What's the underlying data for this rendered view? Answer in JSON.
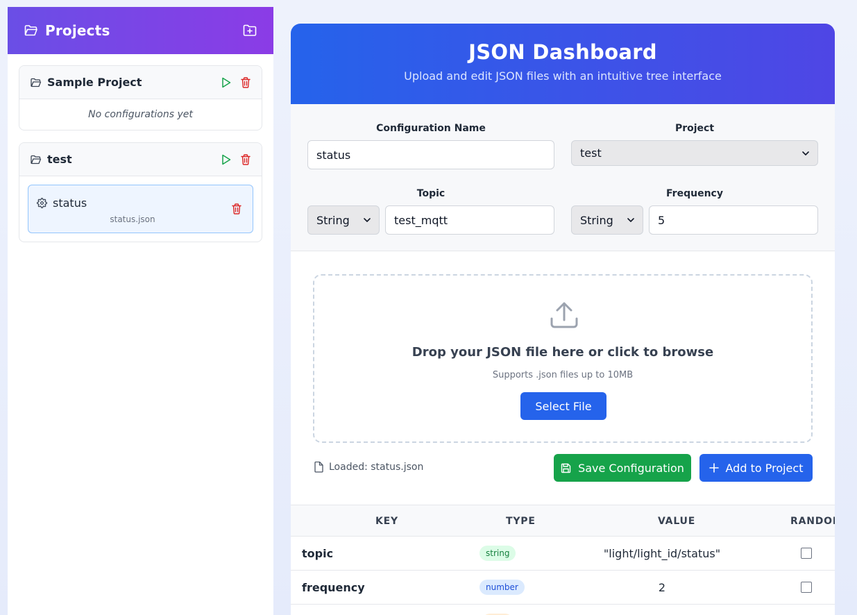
{
  "sidebar": {
    "title": "Projects",
    "projects": [
      {
        "name": "Sample Project",
        "empty_text": "No configurations yet"
      },
      {
        "name": "test",
        "configs": [
          {
            "name": "status",
            "file": "status.json"
          }
        ]
      }
    ]
  },
  "main": {
    "title": "JSON Dashboard",
    "subtitle": "Upload and edit JSON files with an intuitive tree interface",
    "form": {
      "config_name_label": "Configuration Name",
      "config_name_value": "status",
      "project_label": "Project",
      "project_value": "test",
      "topic_label": "Topic",
      "topic_type": "String",
      "topic_value": "test_mqtt",
      "frequency_label": "Frequency",
      "frequency_type": "String",
      "frequency_value": "5"
    },
    "upload": {
      "title": "Drop your JSON file here or click to browse",
      "subtitle": "Supports .json files up to 10MB",
      "select_button": "Select File",
      "loaded_text": "Loaded: status.json",
      "save_button": "Save Configuration",
      "add_button": "Add to Project"
    },
    "table": {
      "headers": [
        "KEY",
        "TYPE",
        "VALUE",
        "RANDOM"
      ],
      "rows": [
        {
          "key": "topic",
          "type": "string",
          "value": "\"light/light_id/status\""
        },
        {
          "key": "frequency",
          "type": "number",
          "value": "2"
        }
      ]
    }
  },
  "colors": {
    "sidebar_header": "#7c3aed",
    "main_header": "#2563eb",
    "save_green": "#16a34a",
    "primary_blue": "#2563eb",
    "delete_red": "#dc2626",
    "play_green": "#16a34a"
  },
  "icons": {
    "folder": "folder-open-icon",
    "new_folder": "folder-plus-icon",
    "play": "play-icon",
    "trash": "trash-icon",
    "gear": "gear-icon",
    "upload": "upload-icon",
    "file": "file-icon",
    "save": "save-icon",
    "plus": "plus-icon",
    "chevron": "chevron-down-icon"
  }
}
